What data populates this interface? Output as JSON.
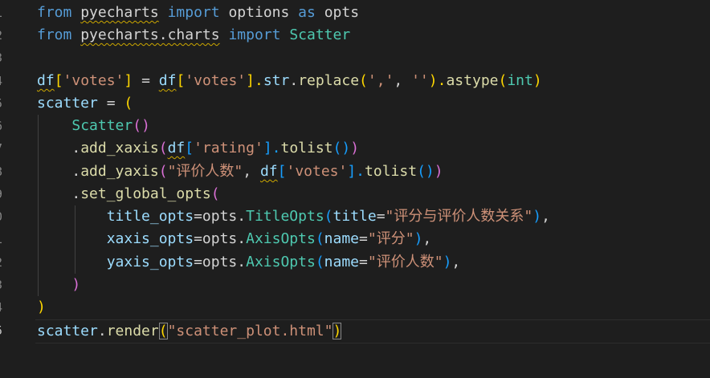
{
  "gutter": {
    "line_numbers": [
      "1",
      "2",
      "3",
      "4",
      "5",
      "6",
      "7",
      "8",
      "9",
      "0",
      "1",
      "2",
      "3",
      "4",
      "5"
    ]
  },
  "code": {
    "l1": [
      "from",
      " ",
      "pyecharts",
      " ",
      "import",
      " ",
      "options",
      " ",
      "as",
      " ",
      "opts"
    ],
    "l2": [
      "from",
      " ",
      "pyecharts.charts",
      " ",
      "import",
      " ",
      "Scatter"
    ],
    "l4": [
      "df",
      "[",
      "'votes'",
      "]",
      " = ",
      "df",
      "[",
      "'votes'",
      "].",
      "str",
      ".",
      "replace",
      "(",
      "','",
      ", ",
      "''",
      ").",
      "astype",
      "(",
      "int",
      ")"
    ],
    "l5": [
      "scatter",
      " = ",
      "("
    ],
    "l6": [
      "    ",
      "Scatter",
      "(",
      ")"
    ],
    "l7": [
      "    .",
      "add_xaxis",
      "(",
      "df",
      "[",
      "'rating'",
      "].",
      "tolist",
      "(",
      ")",
      ")"
    ],
    "l8": [
      "    .",
      "add_yaxis",
      "(",
      "\"评价人数\"",
      ", ",
      "df",
      "[",
      "'votes'",
      "].",
      "tolist",
      "(",
      ")",
      ")"
    ],
    "l9": [
      "    .",
      "set_global_opts",
      "("
    ],
    "l10": [
      "        ",
      "title_opts",
      "=",
      "opts",
      ".",
      "TitleOpts",
      "(",
      "title",
      "=",
      "\"评分与评价人数关系\"",
      ")",
      ","
    ],
    "l11": [
      "        ",
      "xaxis_opts",
      "=",
      "opts",
      ".",
      "AxisOpts",
      "(",
      "name",
      "=",
      "\"评分\"",
      ")",
      ","
    ],
    "l12": [
      "        ",
      "yaxis_opts",
      "=",
      "opts",
      ".",
      "AxisOpts",
      "(",
      "name",
      "=",
      "\"评价人数\"",
      ")",
      ","
    ],
    "l13": [
      "    ",
      ")"
    ],
    "l14": [
      ")"
    ],
    "l15": [
      "scatter",
      ".",
      "render",
      "(",
      "\"scatter_plot.html\"",
      ")"
    ]
  }
}
